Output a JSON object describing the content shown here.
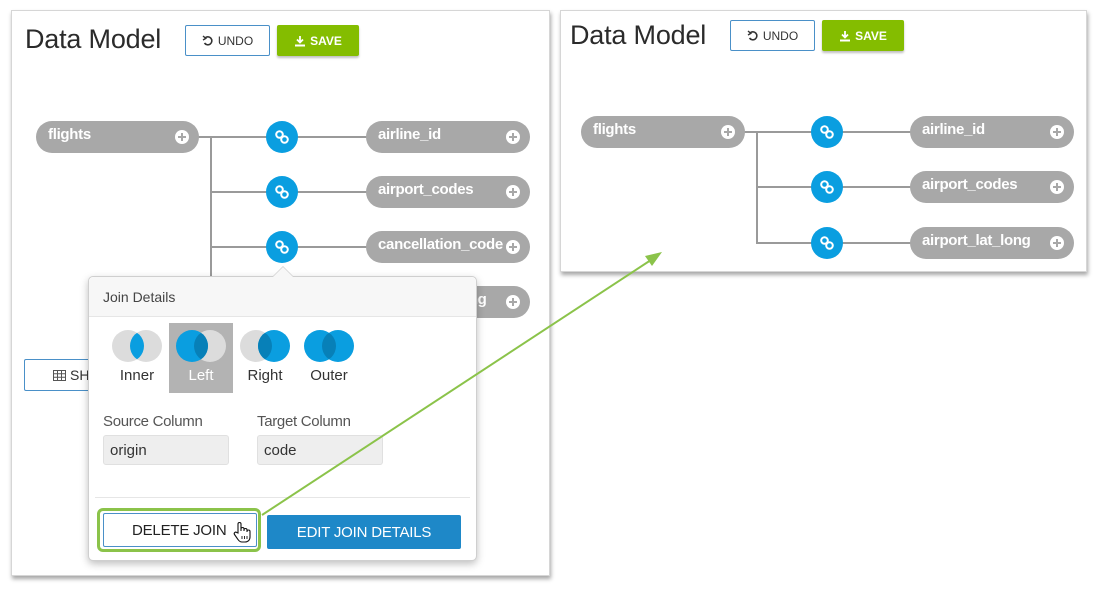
{
  "left_panel": {
    "title": "Data Model",
    "undo_label": "UNDO",
    "save_label": "SAVE",
    "show_button_label": "SH",
    "source_table": "flights",
    "target_tables": [
      "airline_id",
      "airport_codes",
      "cancellation_code",
      "airport_lat_long"
    ],
    "popover": {
      "title": "Join Details",
      "join_types": [
        {
          "label": "Inner",
          "selected": false
        },
        {
          "label": "Left",
          "selected": true
        },
        {
          "label": "Right",
          "selected": false
        },
        {
          "label": "Outer",
          "selected": false
        }
      ],
      "source_column_label": "Source Column",
      "source_column_value": "origin",
      "target_column_label": "Target Column",
      "target_column_value": "code",
      "delete_label": "DELETE JOIN",
      "edit_label": "EDIT JOIN DETAILS"
    }
  },
  "right_panel": {
    "title": "Data Model",
    "undo_label": "UNDO",
    "save_label": "SAVE",
    "source_table": "flights",
    "target_tables": [
      "airline_id",
      "airport_codes",
      "airport_lat_long"
    ]
  },
  "colors": {
    "save_green": "#84bd00",
    "join_blue": "#0a9ee0",
    "node_gray": "#a8a8a8",
    "edit_blue": "#1e88c8",
    "annotation_green": "#8bc34a"
  }
}
